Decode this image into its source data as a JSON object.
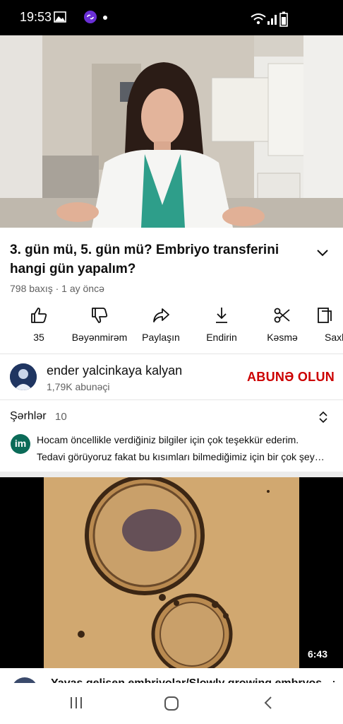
{
  "status_bar": {
    "time": "19:53",
    "icons": [
      "gallery-icon",
      "link-app-icon",
      "dot-icon",
      "wifi-icon",
      "signal-icon",
      "battery-icon"
    ]
  },
  "video": {
    "progress": 0.07,
    "progress_color": "#ff0000"
  },
  "video_info": {
    "title": "3. gün mü, 5. gün mü? Embriyo transferini hangi gün yapalım?",
    "meta": "798 baxış · 1 ay öncə"
  },
  "actions": [
    {
      "icon": "thumbs-up-icon",
      "label": "35"
    },
    {
      "icon": "thumbs-down-icon",
      "label": "Bəyənmirəm"
    },
    {
      "icon": "share-icon",
      "label": "Paylaşın"
    },
    {
      "icon": "download-icon",
      "label": "Endirin"
    },
    {
      "icon": "scissors-icon",
      "label": "Kəsmə"
    },
    {
      "icon": "save-icon",
      "label": "Saxl"
    }
  ],
  "channel": {
    "name": "ender yalcinkaya kalyan",
    "subscribers": "1,79K abunəçi",
    "subscribe_label": "ABUNƏ OLUN",
    "subscribe_color": "#cc0000"
  },
  "comments": {
    "heading": "Şərhlər",
    "count": "10",
    "top_comment": {
      "avatar_text": "im",
      "line1": "Hocam öncellikle verdiğiniz bilgiler için çok teşekkür ederim.",
      "line2": "Tedavi görüyoruz fakat bu kısımları bilmediğimiz için bir çok şey…"
    }
  },
  "next_video": {
    "duration": "6:43",
    "title": "Yavaş gelişen embriyolar/Slowly growing embryos"
  },
  "nav_bar": {
    "icons": [
      "recent-apps-icon",
      "home-icon",
      "back-icon"
    ]
  }
}
